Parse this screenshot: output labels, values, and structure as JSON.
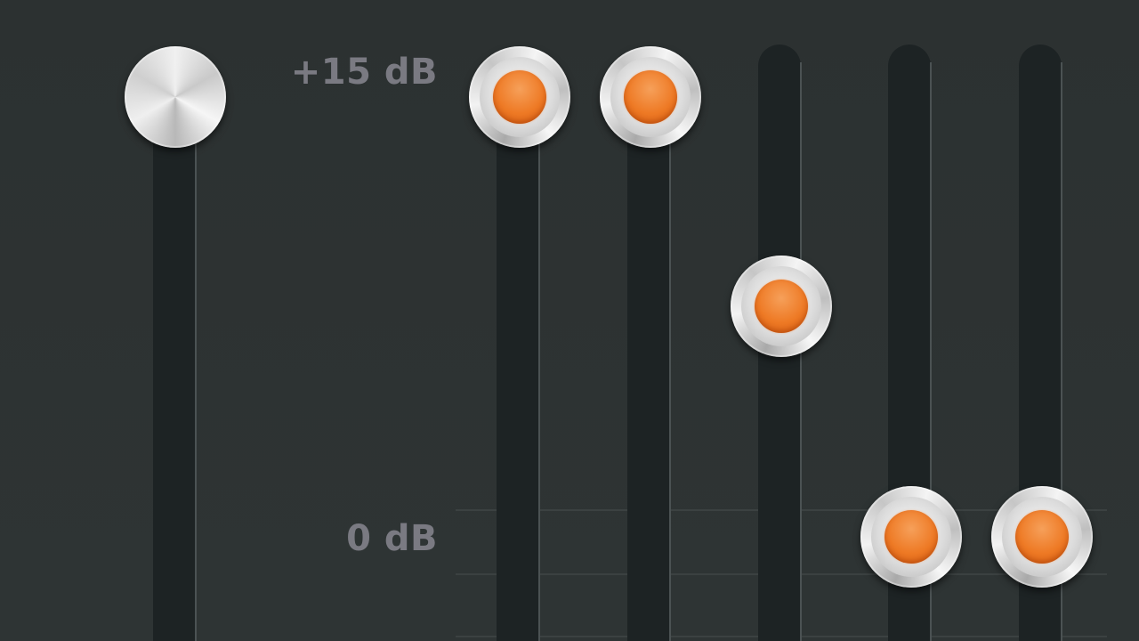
{
  "equalizer": {
    "scale": {
      "top_label": "+15 dB",
      "mid_label": "0 dB"
    },
    "colors": {
      "background": "#2d3232",
      "track": "#1d2324",
      "led": "#ee7a25",
      "label": "#7a7a82"
    },
    "sliders": [
      {
        "name": "preamp",
        "led": false,
        "level_db": 15
      },
      {
        "name": "band-1",
        "led": true,
        "level_db": 15
      },
      {
        "name": "band-2",
        "led": true,
        "level_db": 15
      },
      {
        "name": "band-3",
        "led": true,
        "level_db": 8
      },
      {
        "name": "band-4",
        "led": true,
        "level_db": 0
      },
      {
        "name": "band-5",
        "led": true,
        "level_db": 0
      }
    ]
  }
}
